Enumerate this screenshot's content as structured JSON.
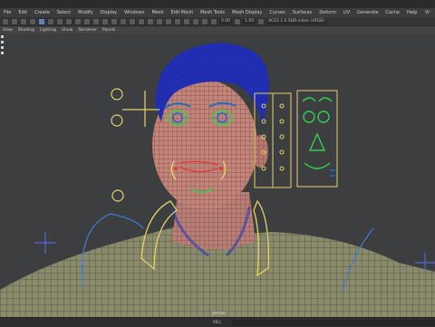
{
  "menubar": {
    "items": [
      "File",
      "Edit",
      "Create",
      "Select",
      "Modify",
      "Display",
      "Windows",
      "Mesh",
      "Edit Mesh",
      "Mesh Tools",
      "Mesh Display",
      "Curves",
      "Surfaces",
      "Deform",
      "UV",
      "Generate",
      "Cache",
      "Help"
    ],
    "workspace_label": "W"
  },
  "toolbar": {
    "time_start": "0.00",
    "time_end": "1.00",
    "color_space": "ACES 1.0 SDR-video (sRGB)"
  },
  "panel_menu": {
    "items": [
      "View",
      "Shading",
      "Lighting",
      "Show",
      "Renderer",
      "Panels"
    ]
  },
  "viewport": {
    "camera_label": "persp"
  },
  "statusbar": {
    "mode_label": "MEL"
  },
  "colors": {
    "ui_bg": "#444444",
    "viewport_bg": "#3d3e40",
    "control_yellow": "#e5d36a",
    "control_green": "#32d14e",
    "wire_blue": "#1f2fb4",
    "highlight_blue": "#5d89b5"
  }
}
